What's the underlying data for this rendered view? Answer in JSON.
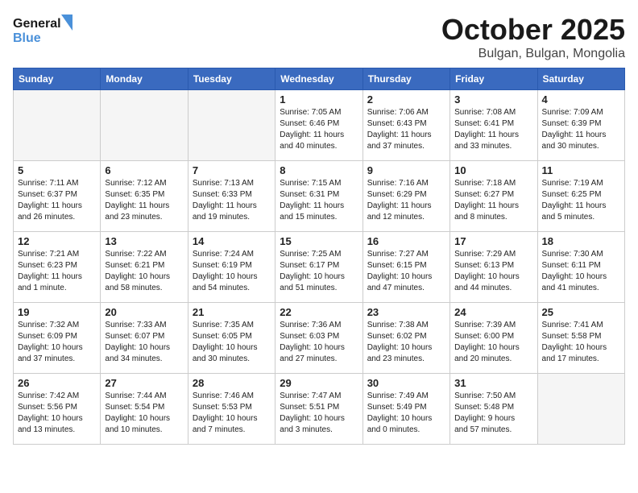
{
  "header": {
    "logo_line1": "General",
    "logo_line2": "Blue",
    "month": "October 2025",
    "location": "Bulgan, Bulgan, Mongolia"
  },
  "days_of_week": [
    "Sunday",
    "Monday",
    "Tuesday",
    "Wednesday",
    "Thursday",
    "Friday",
    "Saturday"
  ],
  "weeks": [
    [
      {
        "day": "",
        "content": ""
      },
      {
        "day": "",
        "content": ""
      },
      {
        "day": "",
        "content": ""
      },
      {
        "day": "1",
        "content": "Sunrise: 7:05 AM\nSunset: 6:46 PM\nDaylight: 11 hours\nand 40 minutes."
      },
      {
        "day": "2",
        "content": "Sunrise: 7:06 AM\nSunset: 6:43 PM\nDaylight: 11 hours\nand 37 minutes."
      },
      {
        "day": "3",
        "content": "Sunrise: 7:08 AM\nSunset: 6:41 PM\nDaylight: 11 hours\nand 33 minutes."
      },
      {
        "day": "4",
        "content": "Sunrise: 7:09 AM\nSunset: 6:39 PM\nDaylight: 11 hours\nand 30 minutes."
      }
    ],
    [
      {
        "day": "5",
        "content": "Sunrise: 7:11 AM\nSunset: 6:37 PM\nDaylight: 11 hours\nand 26 minutes."
      },
      {
        "day": "6",
        "content": "Sunrise: 7:12 AM\nSunset: 6:35 PM\nDaylight: 11 hours\nand 23 minutes."
      },
      {
        "day": "7",
        "content": "Sunrise: 7:13 AM\nSunset: 6:33 PM\nDaylight: 11 hours\nand 19 minutes."
      },
      {
        "day": "8",
        "content": "Sunrise: 7:15 AM\nSunset: 6:31 PM\nDaylight: 11 hours\nand 15 minutes."
      },
      {
        "day": "9",
        "content": "Sunrise: 7:16 AM\nSunset: 6:29 PM\nDaylight: 11 hours\nand 12 minutes."
      },
      {
        "day": "10",
        "content": "Sunrise: 7:18 AM\nSunset: 6:27 PM\nDaylight: 11 hours\nand 8 minutes."
      },
      {
        "day": "11",
        "content": "Sunrise: 7:19 AM\nSunset: 6:25 PM\nDaylight: 11 hours\nand 5 minutes."
      }
    ],
    [
      {
        "day": "12",
        "content": "Sunrise: 7:21 AM\nSunset: 6:23 PM\nDaylight: 11 hours\nand 1 minute."
      },
      {
        "day": "13",
        "content": "Sunrise: 7:22 AM\nSunset: 6:21 PM\nDaylight: 10 hours\nand 58 minutes."
      },
      {
        "day": "14",
        "content": "Sunrise: 7:24 AM\nSunset: 6:19 PM\nDaylight: 10 hours\nand 54 minutes."
      },
      {
        "day": "15",
        "content": "Sunrise: 7:25 AM\nSunset: 6:17 PM\nDaylight: 10 hours\nand 51 minutes."
      },
      {
        "day": "16",
        "content": "Sunrise: 7:27 AM\nSunset: 6:15 PM\nDaylight: 10 hours\nand 47 minutes."
      },
      {
        "day": "17",
        "content": "Sunrise: 7:29 AM\nSunset: 6:13 PM\nDaylight: 10 hours\nand 44 minutes."
      },
      {
        "day": "18",
        "content": "Sunrise: 7:30 AM\nSunset: 6:11 PM\nDaylight: 10 hours\nand 41 minutes."
      }
    ],
    [
      {
        "day": "19",
        "content": "Sunrise: 7:32 AM\nSunset: 6:09 PM\nDaylight: 10 hours\nand 37 minutes."
      },
      {
        "day": "20",
        "content": "Sunrise: 7:33 AM\nSunset: 6:07 PM\nDaylight: 10 hours\nand 34 minutes."
      },
      {
        "day": "21",
        "content": "Sunrise: 7:35 AM\nSunset: 6:05 PM\nDaylight: 10 hours\nand 30 minutes."
      },
      {
        "day": "22",
        "content": "Sunrise: 7:36 AM\nSunset: 6:03 PM\nDaylight: 10 hours\nand 27 minutes."
      },
      {
        "day": "23",
        "content": "Sunrise: 7:38 AM\nSunset: 6:02 PM\nDaylight: 10 hours\nand 23 minutes."
      },
      {
        "day": "24",
        "content": "Sunrise: 7:39 AM\nSunset: 6:00 PM\nDaylight: 10 hours\nand 20 minutes."
      },
      {
        "day": "25",
        "content": "Sunrise: 7:41 AM\nSunset: 5:58 PM\nDaylight: 10 hours\nand 17 minutes."
      }
    ],
    [
      {
        "day": "26",
        "content": "Sunrise: 7:42 AM\nSunset: 5:56 PM\nDaylight: 10 hours\nand 13 minutes."
      },
      {
        "day": "27",
        "content": "Sunrise: 7:44 AM\nSunset: 5:54 PM\nDaylight: 10 hours\nand 10 minutes."
      },
      {
        "day": "28",
        "content": "Sunrise: 7:46 AM\nSunset: 5:53 PM\nDaylight: 10 hours\nand 7 minutes."
      },
      {
        "day": "29",
        "content": "Sunrise: 7:47 AM\nSunset: 5:51 PM\nDaylight: 10 hours\nand 3 minutes."
      },
      {
        "day": "30",
        "content": "Sunrise: 7:49 AM\nSunset: 5:49 PM\nDaylight: 10 hours\nand 0 minutes."
      },
      {
        "day": "31",
        "content": "Sunrise: 7:50 AM\nSunset: 5:48 PM\nDaylight: 9 hours\nand 57 minutes."
      },
      {
        "day": "",
        "content": ""
      }
    ]
  ]
}
